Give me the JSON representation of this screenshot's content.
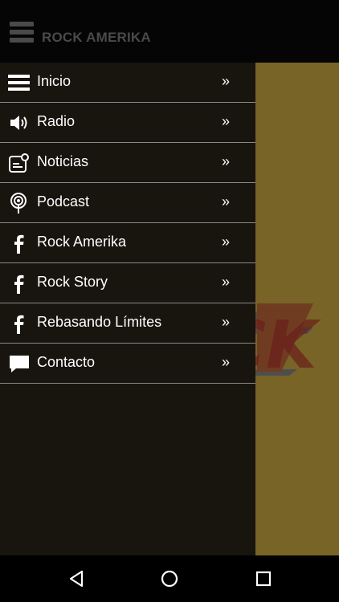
{
  "appbar": {
    "title": "ROCK AMERIKA",
    "menu_icon": "hamburger-icon"
  },
  "background": {
    "logo_text": "ROCK",
    "color": "#786427"
  },
  "drawer": {
    "items": [
      {
        "label": "Inicio",
        "icon": "list-icon",
        "chevron": "»"
      },
      {
        "label": "Radio",
        "icon": "speaker-icon",
        "chevron": "»"
      },
      {
        "label": "Noticias",
        "icon": "news-icon",
        "chevron": "»"
      },
      {
        "label": "Podcast",
        "icon": "podcast-icon",
        "chevron": "»"
      },
      {
        "label": "Rock Amerika",
        "icon": "facebook-icon",
        "chevron": "»"
      },
      {
        "label": "Rock Story",
        "icon": "facebook-icon",
        "chevron": "»"
      },
      {
        "label": "Rebasando Límites",
        "icon": "facebook-icon",
        "chevron": "»"
      },
      {
        "label": "Contacto",
        "icon": "chat-icon",
        "chevron": "»"
      }
    ]
  },
  "navbar": {
    "back": "back-icon",
    "home": "home-icon",
    "recents": "recents-icon"
  }
}
